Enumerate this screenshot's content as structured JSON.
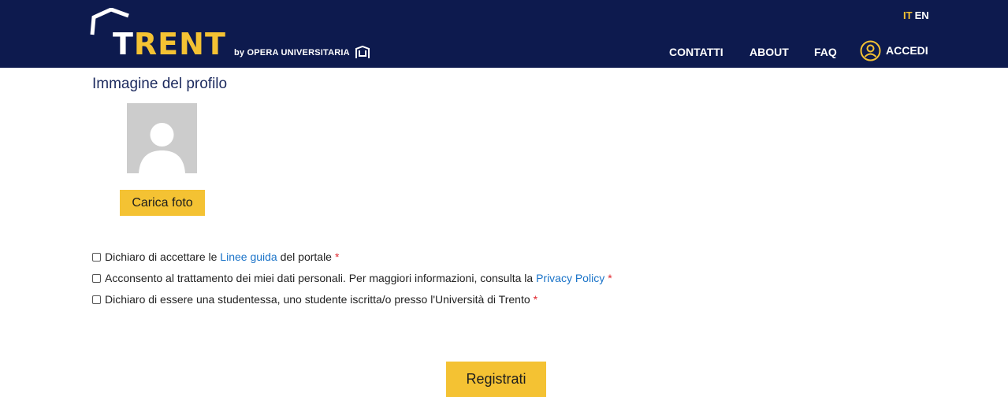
{
  "header": {
    "logo": {
      "word_part1": "T",
      "word_part2": "RENT",
      "tagline": "by OPERA UNIVERSITARIA"
    },
    "languages": [
      {
        "code": "IT",
        "active": true
      },
      {
        "code": "EN",
        "active": false
      }
    ],
    "nav": {
      "contatti": "CONTATTI",
      "about": "ABOUT",
      "faq": "FAQ",
      "accedi": "ACCEDI"
    }
  },
  "profile": {
    "title": "Immagine del profilo",
    "upload_label": "Carica foto"
  },
  "checks": [
    {
      "pre": "Dichiaro di accettare le ",
      "link": "Linee guida",
      "post": " del portale",
      "required": "*"
    },
    {
      "pre": "Acconsento al trattamento dei miei dati personali. Per maggiori informazioni, consulta la ",
      "link": "Privacy Policy",
      "post": "",
      "required": "*"
    },
    {
      "pre": "Dichiaro di essere una studentessa, uno studente iscritta/o presso l'Università di Trento",
      "link": "",
      "post": "",
      "required": "*"
    }
  ],
  "submit_label": "Registrati",
  "colors": {
    "header_bg": "#0d1a4e",
    "accent": "#f4c233",
    "link": "#1a73c8",
    "required": "#e0262d"
  }
}
